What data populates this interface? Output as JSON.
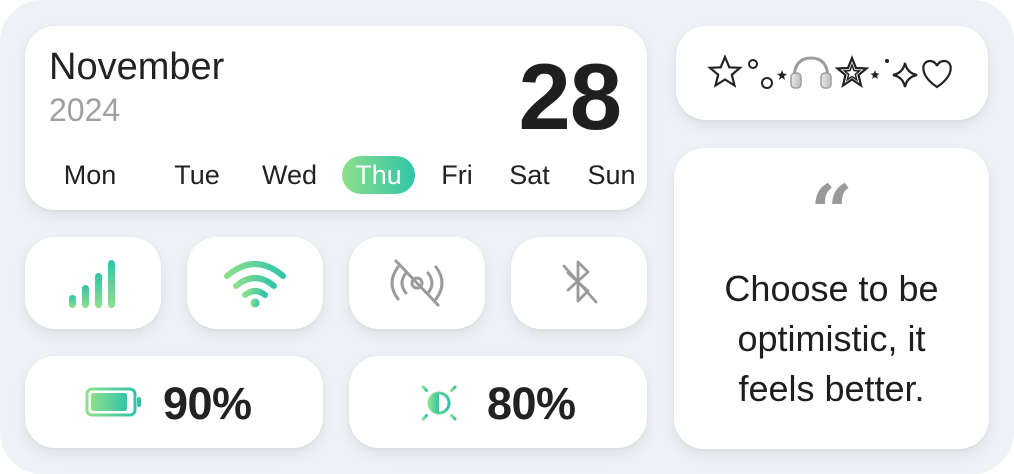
{
  "calendar": {
    "month": "November",
    "year": "2024",
    "day": "28",
    "weekdays": [
      "Mon",
      "Tue",
      "Wed",
      "Thu",
      "Fri",
      "Sat",
      "Sun"
    ],
    "active_weekday": "Thu"
  },
  "toggles": {
    "signal": {
      "icon": "cellular-signal-icon",
      "state": "on"
    },
    "wifi": {
      "icon": "wifi-icon",
      "state": "on"
    },
    "nfc": {
      "icon": "nfc-off-icon",
      "state": "off"
    },
    "bluetooth": {
      "icon": "bluetooth-off-icon",
      "state": "off"
    }
  },
  "battery": {
    "label": "90%",
    "level": 0.9,
    "icon": "battery-icon"
  },
  "brightness": {
    "label": "80%",
    "level": 0.8,
    "icon": "brightness-icon"
  },
  "decor": {
    "icons": [
      "star-outline-icon",
      "sparkle-dots-icon",
      "headphones-icon",
      "star-outline-icon",
      "sparkle-dots-icon",
      "diamond-icon",
      "heart-outline-icon"
    ]
  },
  "quote": {
    "lines": [
      "Choose to be",
      "optimistic, it",
      "feels better."
    ]
  },
  "colors": {
    "accent_light": "#8de08b",
    "accent_dark": "#31c4a8",
    "inactive_icon": "#9a9a9a",
    "background": "#eef2f6"
  }
}
